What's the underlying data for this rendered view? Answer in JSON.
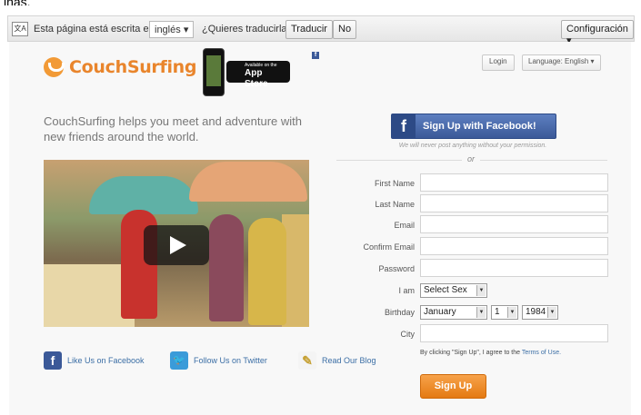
{
  "top_cut_text": "inas.",
  "translate_bar": {
    "icon": "translate-icon",
    "message": "Esta página está escrita en",
    "language_value": "inglés",
    "question": "¿Quieres traducirla?",
    "translate_label": "Traducir",
    "no_label": "No",
    "config_label": "Configuración"
  },
  "header": {
    "logo_text": "CouchSurfing",
    "appstore_small": "Available on the",
    "appstore_big": "App Store",
    "fb_mini": "f",
    "login_label": "Login",
    "language_label": "Language: English"
  },
  "hero": {
    "tagline": "CouchSurfing helps you meet and adventure with new friends around the world."
  },
  "social": {
    "facebook": "Like Us on Facebook",
    "twitter": "Follow Us on Twitter",
    "blog": "Read Our Blog"
  },
  "signup": {
    "facebook_button": "Sign Up with Facebook!",
    "facebook_note": "We will never post anything without your permission.",
    "or_text": "or",
    "fields": [
      {
        "label": "First Name"
      },
      {
        "label": "Last Name"
      },
      {
        "label": "Email"
      },
      {
        "label": "Confirm Email"
      },
      {
        "label": "Password"
      }
    ],
    "iam_label": "I am",
    "sex_value": "Select Sex",
    "birthday_label": "Birthday",
    "birthday_month": "January",
    "birthday_day": "1",
    "birthday_year": "1984",
    "city_label": "City",
    "terms_text": "By clicking \"Sign Up\", I agree to the",
    "terms_link": "Terms of Use.",
    "submit_label": "Sign Up"
  },
  "colors": {
    "brand_orange": "#e9852c",
    "facebook_blue": "#3b5998",
    "signup_orange": "#e47a12"
  }
}
